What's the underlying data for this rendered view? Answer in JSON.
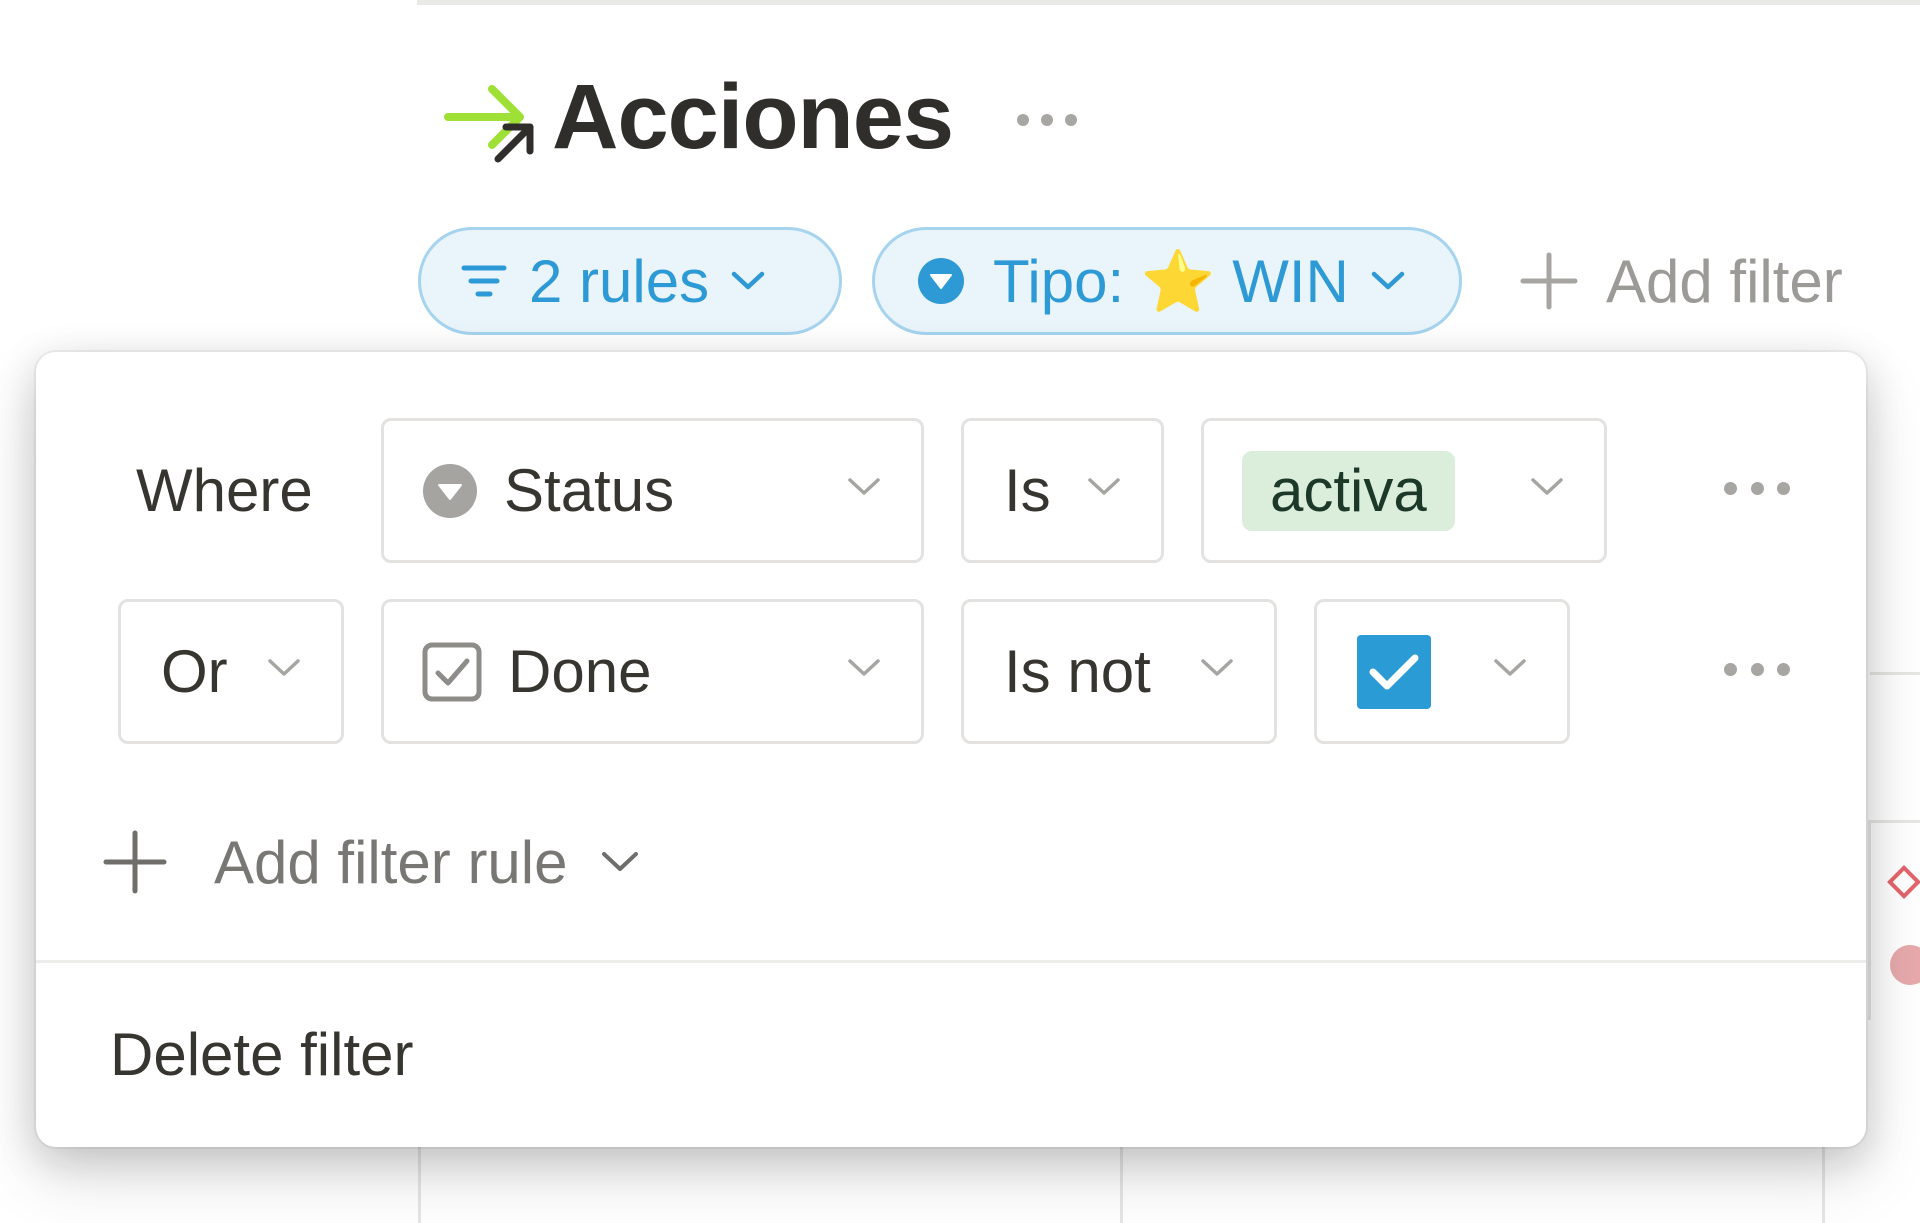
{
  "page": {
    "title": "Acciones",
    "title_icon": "arrow-right-icon"
  },
  "filter_bar": {
    "rules_chip": {
      "label": "2 rules",
      "icon": "filter-lines-icon"
    },
    "tipo_chip": {
      "label": "Tipo: ⭐ WIN",
      "icon": "select-property-icon"
    },
    "add_filter": {
      "label": "Add filter",
      "icon": "plus-icon"
    }
  },
  "filter_popover": {
    "rules": [
      {
        "conjunction": "Where",
        "property": "Status",
        "property_icon": "status-property-icon",
        "operator": "Is",
        "value": "activa",
        "value_color": "#dbeddb"
      },
      {
        "conjunction": "Or",
        "property": "Done",
        "property_icon": "checkbox-property-icon",
        "operator": "Is not",
        "value_checked": true,
        "value_color": "#2a9bd5"
      }
    ],
    "add_rule": {
      "label": "Add filter rule"
    },
    "delete_filter": {
      "label": "Delete filter"
    }
  },
  "colors": {
    "accent_blue": "#2d9ad6",
    "chip_background": "#e9f4fb",
    "chip_border": "#a6d4ef",
    "title_arrow": "#9ee036"
  }
}
